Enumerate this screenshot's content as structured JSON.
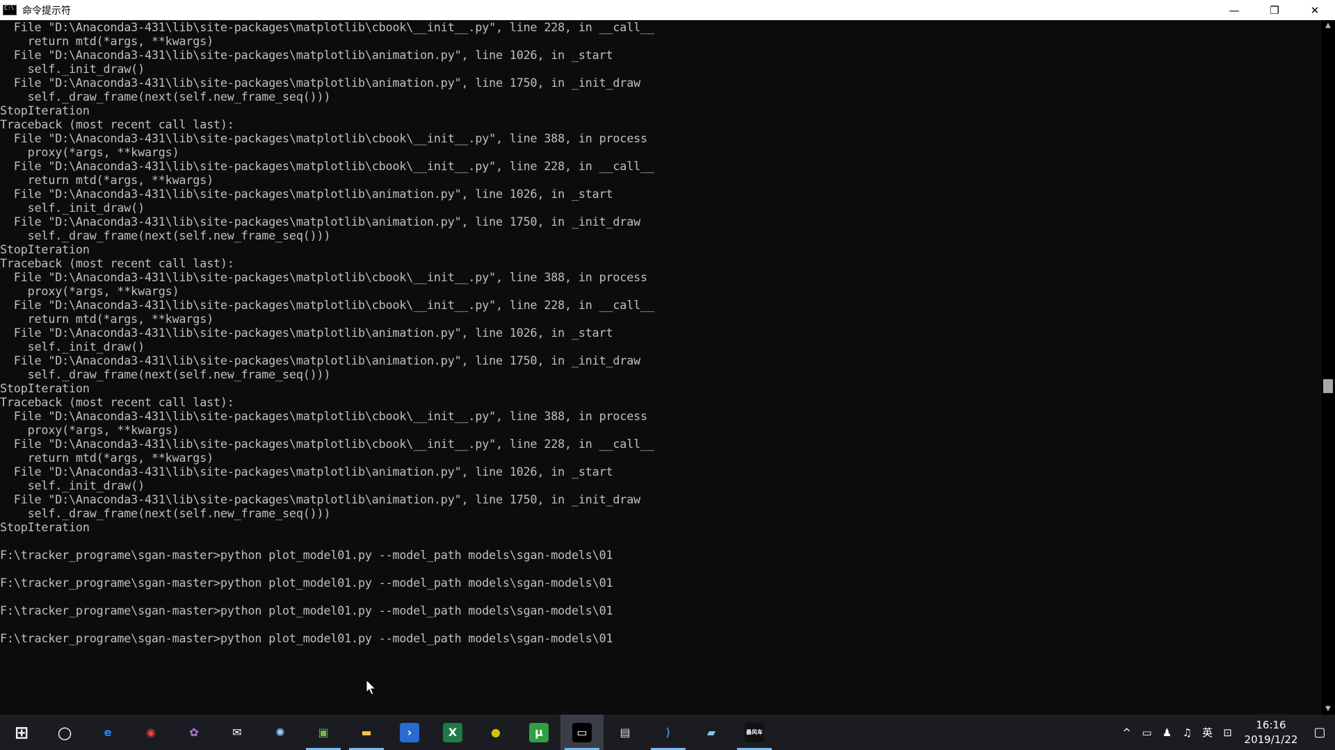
{
  "window": {
    "title": "命令提示符",
    "minimize": "—",
    "restore": "❐",
    "close": "✕"
  },
  "console": {
    "lines": [
      "  File \"D:\\Anaconda3-431\\lib\\site-packages\\matplotlib\\cbook\\__init__.py\", line 228, in __call__",
      "    return mtd(*args, **kwargs)",
      "  File \"D:\\Anaconda3-431\\lib\\site-packages\\matplotlib\\animation.py\", line 1026, in _start",
      "    self._init_draw()",
      "  File \"D:\\Anaconda3-431\\lib\\site-packages\\matplotlib\\animation.py\", line 1750, in _init_draw",
      "    self._draw_frame(next(self.new_frame_seq()))",
      "StopIteration",
      "Traceback (most recent call last):",
      "  File \"D:\\Anaconda3-431\\lib\\site-packages\\matplotlib\\cbook\\__init__.py\", line 388, in process",
      "    proxy(*args, **kwargs)",
      "  File \"D:\\Anaconda3-431\\lib\\site-packages\\matplotlib\\cbook\\__init__.py\", line 228, in __call__",
      "    return mtd(*args, **kwargs)",
      "  File \"D:\\Anaconda3-431\\lib\\site-packages\\matplotlib\\animation.py\", line 1026, in _start",
      "    self._init_draw()",
      "  File \"D:\\Anaconda3-431\\lib\\site-packages\\matplotlib\\animation.py\", line 1750, in _init_draw",
      "    self._draw_frame(next(self.new_frame_seq()))",
      "StopIteration",
      "Traceback (most recent call last):",
      "  File \"D:\\Anaconda3-431\\lib\\site-packages\\matplotlib\\cbook\\__init__.py\", line 388, in process",
      "    proxy(*args, **kwargs)",
      "  File \"D:\\Anaconda3-431\\lib\\site-packages\\matplotlib\\cbook\\__init__.py\", line 228, in __call__",
      "    return mtd(*args, **kwargs)",
      "  File \"D:\\Anaconda3-431\\lib\\site-packages\\matplotlib\\animation.py\", line 1026, in _start",
      "    self._init_draw()",
      "  File \"D:\\Anaconda3-431\\lib\\site-packages\\matplotlib\\animation.py\", line 1750, in _init_draw",
      "    self._draw_frame(next(self.new_frame_seq()))",
      "StopIteration",
      "Traceback (most recent call last):",
      "  File \"D:\\Anaconda3-431\\lib\\site-packages\\matplotlib\\cbook\\__init__.py\", line 388, in process",
      "    proxy(*args, **kwargs)",
      "  File \"D:\\Anaconda3-431\\lib\\site-packages\\matplotlib\\cbook\\__init__.py\", line 228, in __call__",
      "    return mtd(*args, **kwargs)",
      "  File \"D:\\Anaconda3-431\\lib\\site-packages\\matplotlib\\animation.py\", line 1026, in _start",
      "    self._init_draw()",
      "  File \"D:\\Anaconda3-431\\lib\\site-packages\\matplotlib\\animation.py\", line 1750, in _init_draw",
      "    self._draw_frame(next(self.new_frame_seq()))",
      "StopIteration",
      "",
      "F:\\tracker_programe\\sgan-master>python plot_model01.py --model_path models\\sgan-models\\01",
      "",
      "F:\\tracker_programe\\sgan-master>python plot_model01.py --model_path models\\sgan-models\\01",
      "",
      "F:\\tracker_programe\\sgan-master>python plot_model01.py --model_path models\\sgan-models\\01",
      "",
      "F:\\tracker_programe\\sgan-master>python plot_model01.py --model_path models\\sgan-models\\01"
    ]
  },
  "taskbar": {
    "items": [
      {
        "name": "start-button",
        "icon": "windows-logo-icon",
        "glyph": "⊞",
        "color": "#ffffff",
        "bg": "transparent"
      },
      {
        "name": "search-button",
        "icon": "search-circle-icon",
        "glyph": "○",
        "color": "#ffffff",
        "bg": "transparent"
      },
      {
        "name": "taskbar-edge",
        "icon": "edge-icon",
        "glyph": "e",
        "color": "#1e90ff",
        "bg": "transparent"
      },
      {
        "name": "taskbar-chrome",
        "icon": "chrome-icon",
        "glyph": "◉",
        "color": "#e8453c",
        "bg": "transparent"
      },
      {
        "name": "taskbar-app-4",
        "icon": "paint-palette-icon",
        "glyph": "✿",
        "color": "#b07ad8",
        "bg": "transparent"
      },
      {
        "name": "taskbar-mail",
        "icon": "mail-icon",
        "glyph": "✉",
        "color": "#ffffff",
        "bg": "transparent"
      },
      {
        "name": "taskbar-app-6",
        "icon": "pinwheel-icon",
        "glyph": "✺",
        "color": "#9ad1ff",
        "bg": "transparent"
      },
      {
        "name": "taskbar-app-7",
        "icon": "image-viewer-icon",
        "glyph": "▣",
        "color": "#6fbf4a",
        "bg": "transparent"
      },
      {
        "name": "taskbar-explorer",
        "icon": "folder-icon",
        "glyph": "▬",
        "color": "#f5c542",
        "bg": "transparent"
      },
      {
        "name": "taskbar-powershell",
        "icon": "powershell-icon",
        "glyph": "›",
        "color": "#ffffff",
        "bg": "#2a6bd1"
      },
      {
        "name": "taskbar-excel",
        "icon": "excel-icon",
        "glyph": "X",
        "color": "#ffffff",
        "bg": "#1f7a45"
      },
      {
        "name": "taskbar-app-11",
        "icon": "green-globe-icon",
        "glyph": "●",
        "color": "#d4c400",
        "bg": "transparent"
      },
      {
        "name": "taskbar-utorrent",
        "icon": "utorrent-icon",
        "glyph": "μ",
        "color": "#ffffff",
        "bg": "#2f9e44"
      },
      {
        "name": "taskbar-cmd",
        "icon": "terminal-icon",
        "glyph": "▭",
        "color": "#ffffff",
        "bg": "#000000"
      },
      {
        "name": "taskbar-app-14",
        "icon": "document-icon",
        "glyph": "▤",
        "color": "#dddddd",
        "bg": "transparent"
      },
      {
        "name": "taskbar-vscode",
        "icon": "vscode-icon",
        "glyph": "⟩",
        "color": "#2f8be6",
        "bg": "transparent"
      },
      {
        "name": "taskbar-app-16",
        "icon": "notepad-icon",
        "glyph": "▰",
        "color": "#7fc8e8",
        "bg": "transparent"
      },
      {
        "name": "taskbar-app-17",
        "icon": "video-app-icon",
        "glyph": "暴风车",
        "color": "#ffffff",
        "bg": "#111111"
      }
    ]
  },
  "tray": {
    "chevron": "^",
    "network": "▭",
    "app": "♟",
    "volume": "♫",
    "ime": "英",
    "input": "⊡",
    "time": "16:16",
    "date": "2019/1/22",
    "notifications": "▢"
  }
}
